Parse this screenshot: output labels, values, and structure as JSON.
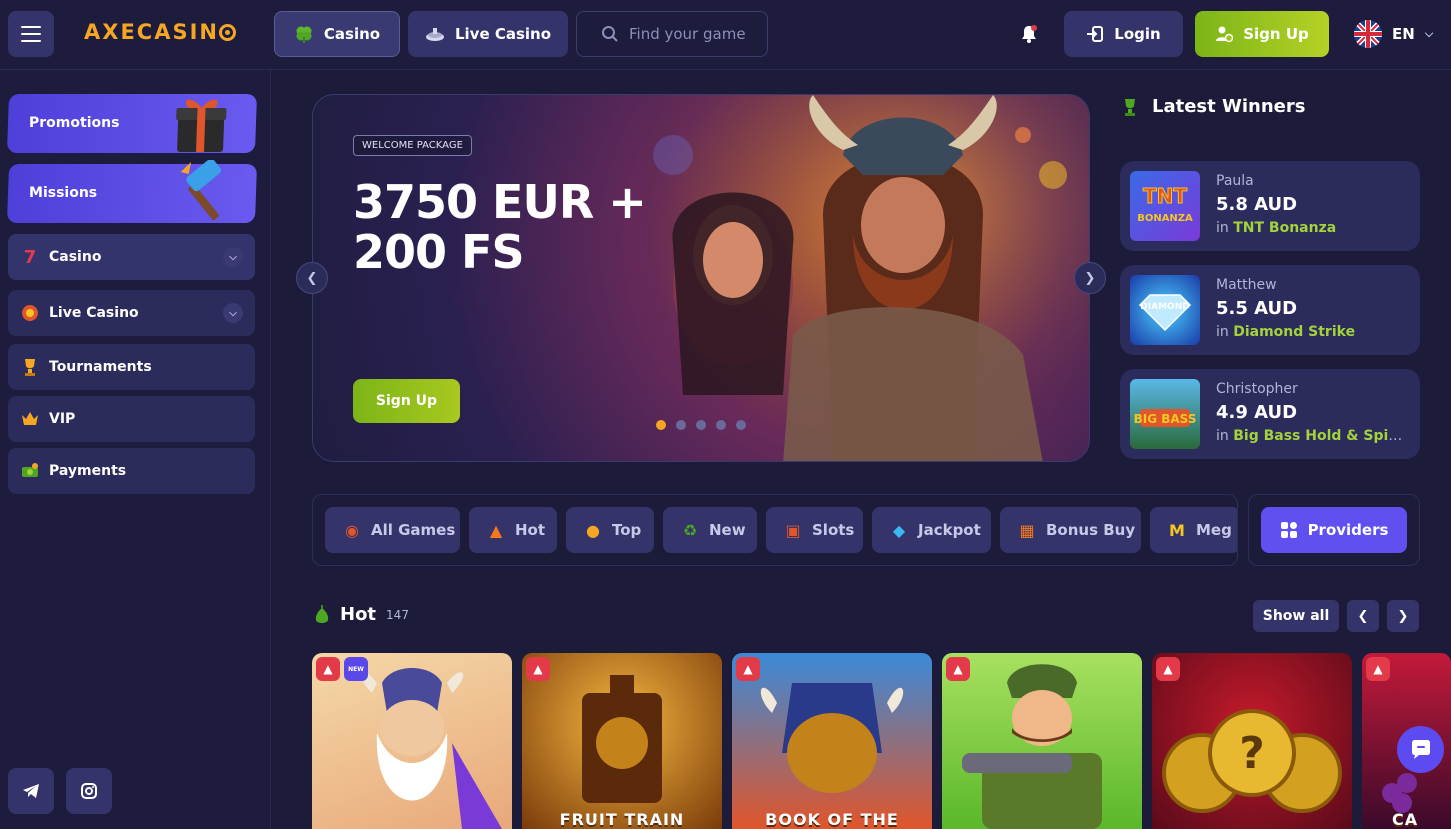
{
  "header": {
    "logo": "AXECASIN",
    "nav": [
      {
        "label": "Casino",
        "icon": "clover-icon"
      },
      {
        "label": "Live Casino",
        "icon": "dealer-icon"
      }
    ],
    "search_placeholder": "Find your game",
    "login_label": "Login",
    "signup_label": "Sign Up",
    "language": "EN"
  },
  "sidebar": {
    "promos": [
      {
        "label": "Promotions"
      },
      {
        "label": "Missions"
      }
    ],
    "items": [
      {
        "label": "Casino",
        "icon": "seven-icon"
      },
      {
        "label": "Live Casino",
        "icon": "chip-icon"
      },
      {
        "label": "Tournaments",
        "icon": "trophy-icon"
      },
      {
        "label": "VIP",
        "icon": "crown-icon"
      },
      {
        "label": "Payments",
        "icon": "money-icon"
      }
    ],
    "social": [
      "telegram-icon",
      "instagram-icon"
    ]
  },
  "hero": {
    "badge": "WELCOME PACKAGE",
    "title": "3750 EUR + 200 FS",
    "cta": "Sign Up",
    "slides_count": 5,
    "active_slide": 1
  },
  "winners": {
    "title": "Latest Winners",
    "in_label": "in",
    "items": [
      {
        "name": "Paula",
        "amount": "5.8 AUD",
        "game": "TNT Bonanza"
      },
      {
        "name": "Matthew",
        "amount": "5.5 AUD",
        "game": "Diamond Strike"
      },
      {
        "name": "Christopher",
        "amount": "4.9 AUD",
        "game": "Big Bass Hold & Spinner Megaways"
      }
    ]
  },
  "categories": {
    "items": [
      {
        "label": "All Games",
        "icon": "joystick-icon"
      },
      {
        "label": "Hot",
        "icon": "fire-icon"
      },
      {
        "label": "Top",
        "icon": "medal-icon"
      },
      {
        "label": "New",
        "icon": "recycle-icon"
      },
      {
        "label": "Slots",
        "icon": "slot-machine-icon"
      },
      {
        "label": "Jackpot",
        "icon": "diamond-icon"
      },
      {
        "label": "Bonus Buy",
        "icon": "gift-icon"
      },
      {
        "label": "Meg",
        "icon": "megaways-icon"
      }
    ],
    "providers_label": "Providers"
  },
  "hot": {
    "title": "Hot",
    "count": "147",
    "show_all": "Show all",
    "new_badge": "NEW",
    "games": [
      {
        "title": "",
        "badge_new": true
      },
      {
        "title": "FRUIT TRAIN"
      },
      {
        "title": "BOOK OF THE"
      },
      {
        "title": ""
      },
      {
        "title": ""
      },
      {
        "title": "CA"
      }
    ]
  },
  "colors": {
    "background": "#1c1b3a",
    "accent_purple": "#6050f0",
    "accent_green": "#7cb518",
    "accent_orange": "#f5a623",
    "game_link_green": "#a4d23a"
  }
}
